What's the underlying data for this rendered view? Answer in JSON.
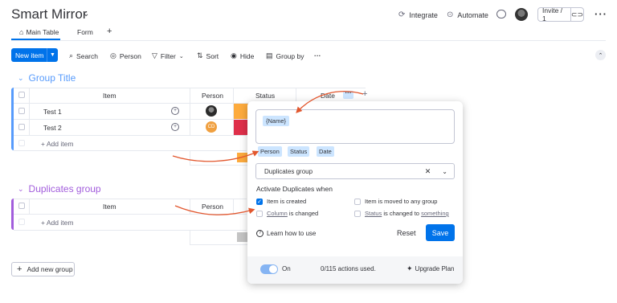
{
  "board": {
    "title": "Smart Mirror",
    "integrate_label": "Integrate",
    "automate_label": "Automate",
    "invite_label": "Invite / 1"
  },
  "tabs": [
    {
      "label": "Main Table"
    },
    {
      "label": "Form"
    },
    {
      "label": "+"
    }
  ],
  "toolbar": {
    "new_item": "New item",
    "search": "Search",
    "person": "Person",
    "filter": "Filter",
    "sort": "Sort",
    "hide": "Hide",
    "group_by": "Group by",
    "more": "···"
  },
  "columns": {
    "item": "Item",
    "person": "Person",
    "status": "Status",
    "date": "Date"
  },
  "groups": [
    {
      "title": "Group Title",
      "color": "#579bfc",
      "rows": [
        {
          "name": "Test 1",
          "person": "photo",
          "status_color": "#fdab3d"
        },
        {
          "name": "Test 2",
          "person": "CD",
          "status_color": "#df2f4a"
        }
      ],
      "add_item": "+ Add item"
    },
    {
      "title": "Duplicates group",
      "color": "#a25ddc",
      "add_item": "+ Add item"
    }
  ],
  "add_group_label": "Add new group",
  "popup": {
    "template_token": "{Name}",
    "variables": [
      "Person",
      "Status",
      "Date"
    ],
    "target_group": "Duplicates group",
    "section_title": "Activate Duplicates when",
    "options": {
      "item_created": "Item is created",
      "column_changed_link": "Column",
      "column_changed_rest": " is changed",
      "moved": "Item is moved to any group",
      "status_link": "Status",
      "status_mid": " is changed to ",
      "status_something": "something"
    },
    "learn": "Learn how to use",
    "reset": "Reset",
    "save": "Save",
    "toggle_label": "On",
    "actions_used": "0/115 actions used.",
    "upgrade": "Upgrade Plan"
  },
  "colors": {
    "accent": "#0073ea",
    "annotation_arrow": "#e2572e",
    "status_orange": "#fdab3d",
    "status_red": "#df2f4a",
    "avatar_cd": "#f0a040"
  }
}
